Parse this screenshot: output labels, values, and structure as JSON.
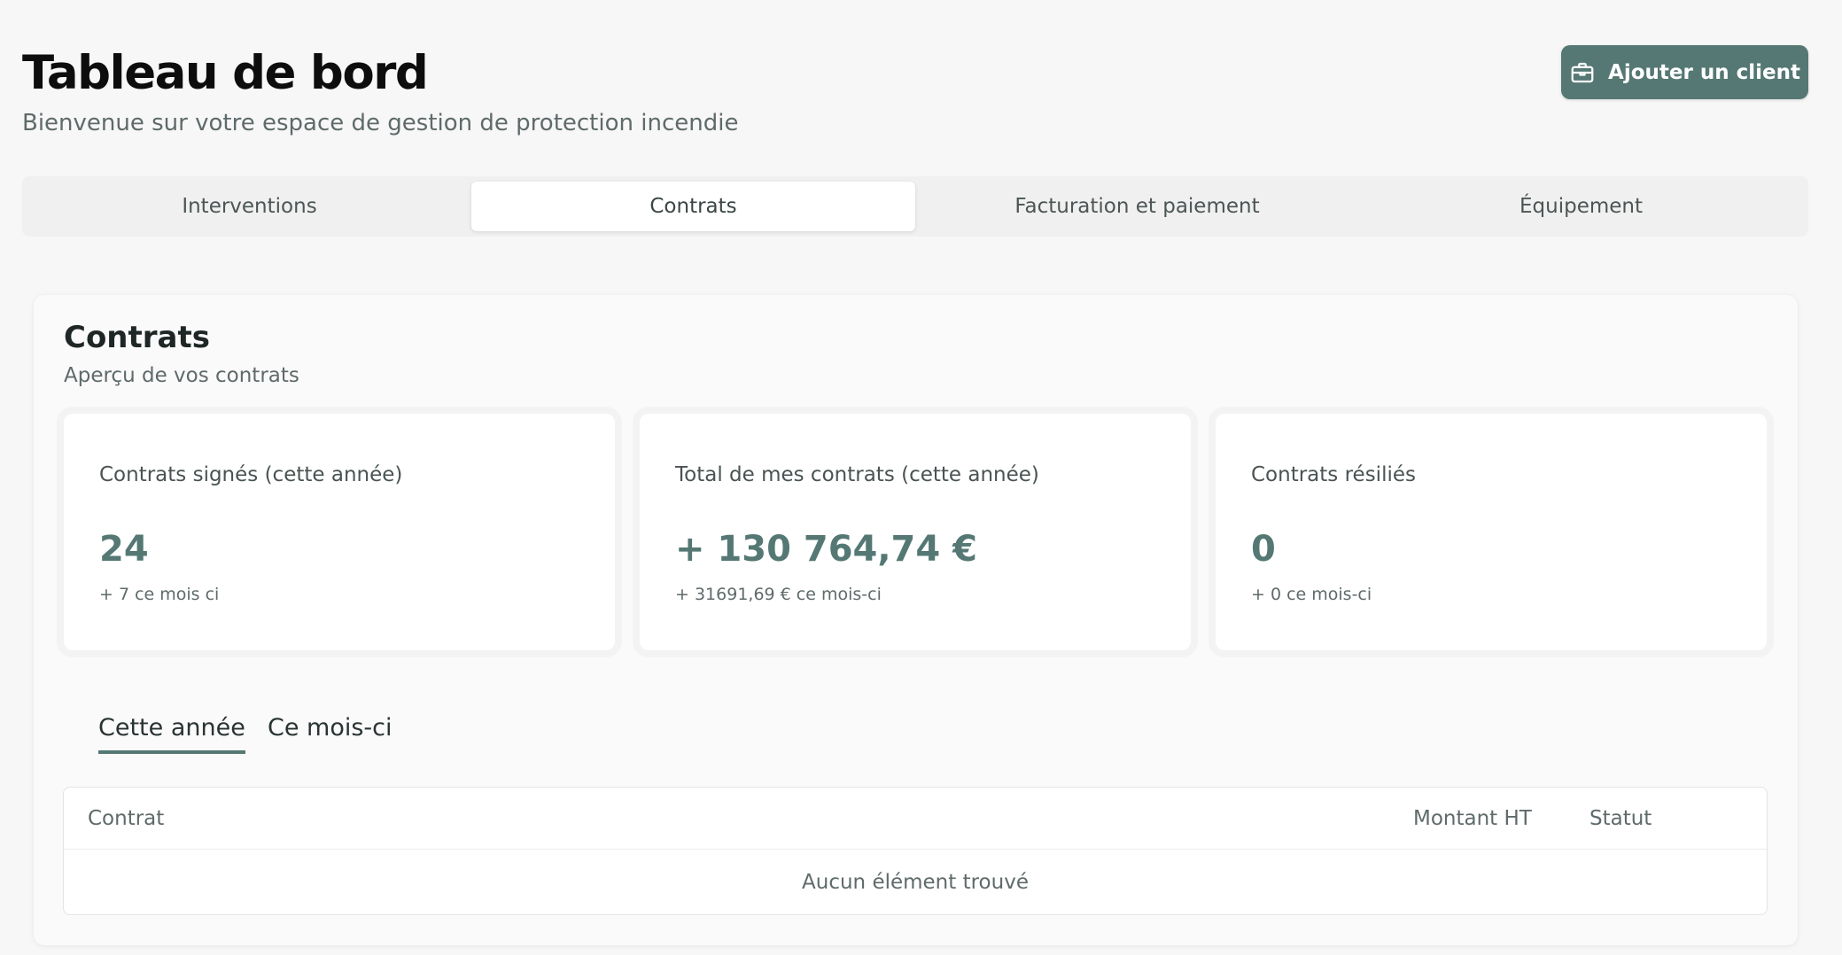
{
  "header": {
    "title": "Tableau de bord",
    "subtitle": "Bienvenue sur votre espace de gestion de protection incendie",
    "add_client_label": "Ajouter un client",
    "add_client_icon": "briefcase-icon",
    "accent_color": "#557874"
  },
  "tabs": [
    {
      "label": "Interventions",
      "active": false
    },
    {
      "label": "Contrats",
      "active": true
    },
    {
      "label": "Facturation et paiement",
      "active": false
    },
    {
      "label": "Équipement",
      "active": false
    }
  ],
  "contracts": {
    "title": "Contrats",
    "subtitle": "Aperçu de vos  contrats",
    "stats": [
      {
        "label": "Contrats signés (cette année)",
        "value": "24",
        "delta": "+ 7 ce mois ci"
      },
      {
        "label": "Total de mes contrats (cette année)",
        "value": "+ 130 764,74 €",
        "delta": "+ 31691,69 € ce mois-ci"
      },
      {
        "label": "Contrats résiliés",
        "value": "0",
        "delta": "+ 0 ce mois-ci"
      }
    ],
    "period_tabs": [
      {
        "label": "Cette année",
        "active": true
      },
      {
        "label": "Ce mois-ci",
        "active": false
      }
    ],
    "table": {
      "columns": [
        "Contrat",
        "Montant  HT",
        "Statut"
      ],
      "empty_message": "Aucun élément trouvé"
    }
  }
}
